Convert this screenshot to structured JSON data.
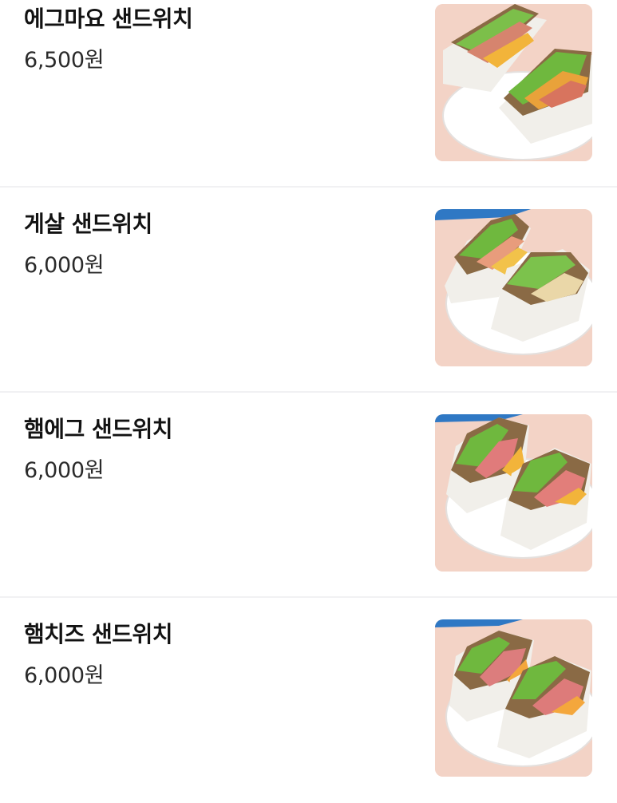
{
  "menu": {
    "items": [
      {
        "name": "에그마요 샌드위치",
        "price": "6,500원",
        "photo": "sandwich-egg-mayo"
      },
      {
        "name": "게살 샌드위치",
        "price": "6,000원",
        "photo": "sandwich-crab"
      },
      {
        "name": "햄에그 샌드위치",
        "price": "6,000원",
        "photo": "sandwich-ham-egg"
      },
      {
        "name": "햄치즈 샌드위치",
        "price": "6,000원",
        "photo": "sandwich-ham-cheese"
      }
    ]
  },
  "colors": {
    "background": "#ffffff",
    "divider": "#f1f1f3",
    "name_text": "#121212",
    "price_text": "#2a2a2a",
    "photo_backdrop": "#f3d3c6",
    "photo_top_strip": "#2f78c4"
  }
}
